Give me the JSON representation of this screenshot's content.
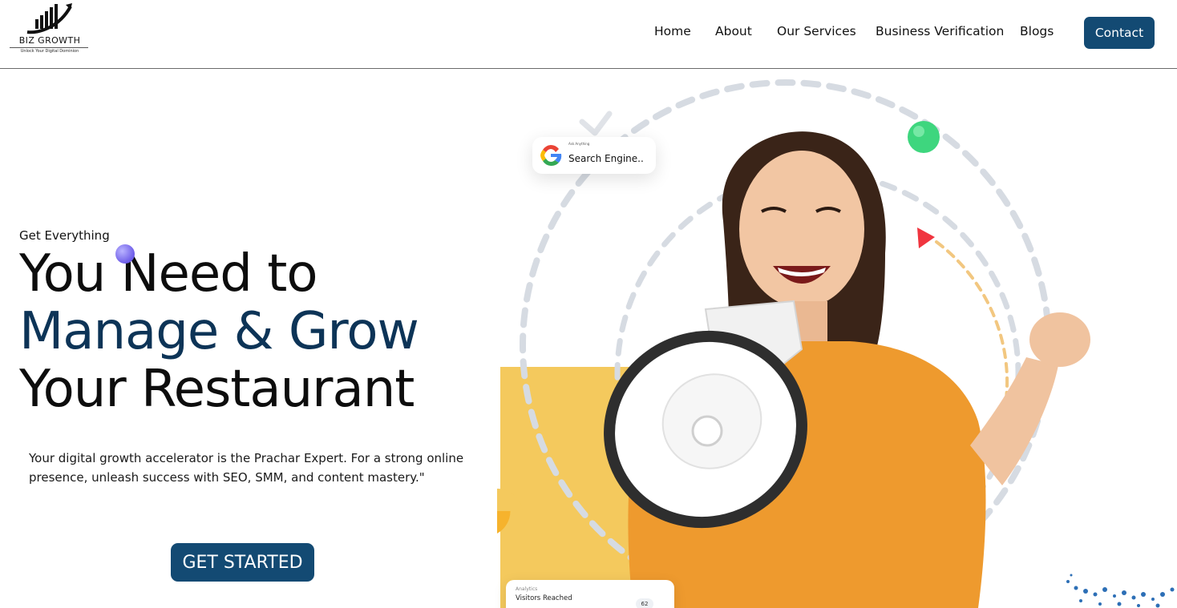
{
  "brand": {
    "name": "BIZ GROWTH",
    "tagline": "Unlock Your Digital Dominion"
  },
  "nav": {
    "items": [
      {
        "label": "Home"
      },
      {
        "label": "About"
      },
      {
        "label": "Our Services"
      },
      {
        "label": "Business Verification"
      },
      {
        "label": "Blogs"
      }
    ],
    "contact_label": "Contact"
  },
  "hero": {
    "eyebrow": "Get Everything",
    "headline_line1": "You Need to",
    "headline_line2": "Manage & Grow",
    "headline_line3": "Your Restaurant",
    "description": "Your digital growth accelerator is the Prachar Expert. For a strong online presence, unleash success with SEO, SMM, and content mastery.\"",
    "cta_label": "GET STARTED"
  },
  "search_card": {
    "caption": "Ask Anything",
    "text": "Search Engine.."
  },
  "analytics_card": {
    "label": "Analytics",
    "title": "Visitors Reached",
    "value": "62"
  },
  "colors": {
    "primary": "#134a73",
    "headline_accent": "#0d3457",
    "yellow": "#f4c95d",
    "orange_shirt": "#ee9a2e",
    "green_ball": "#3ed67e",
    "red_play": "#f0353f"
  }
}
